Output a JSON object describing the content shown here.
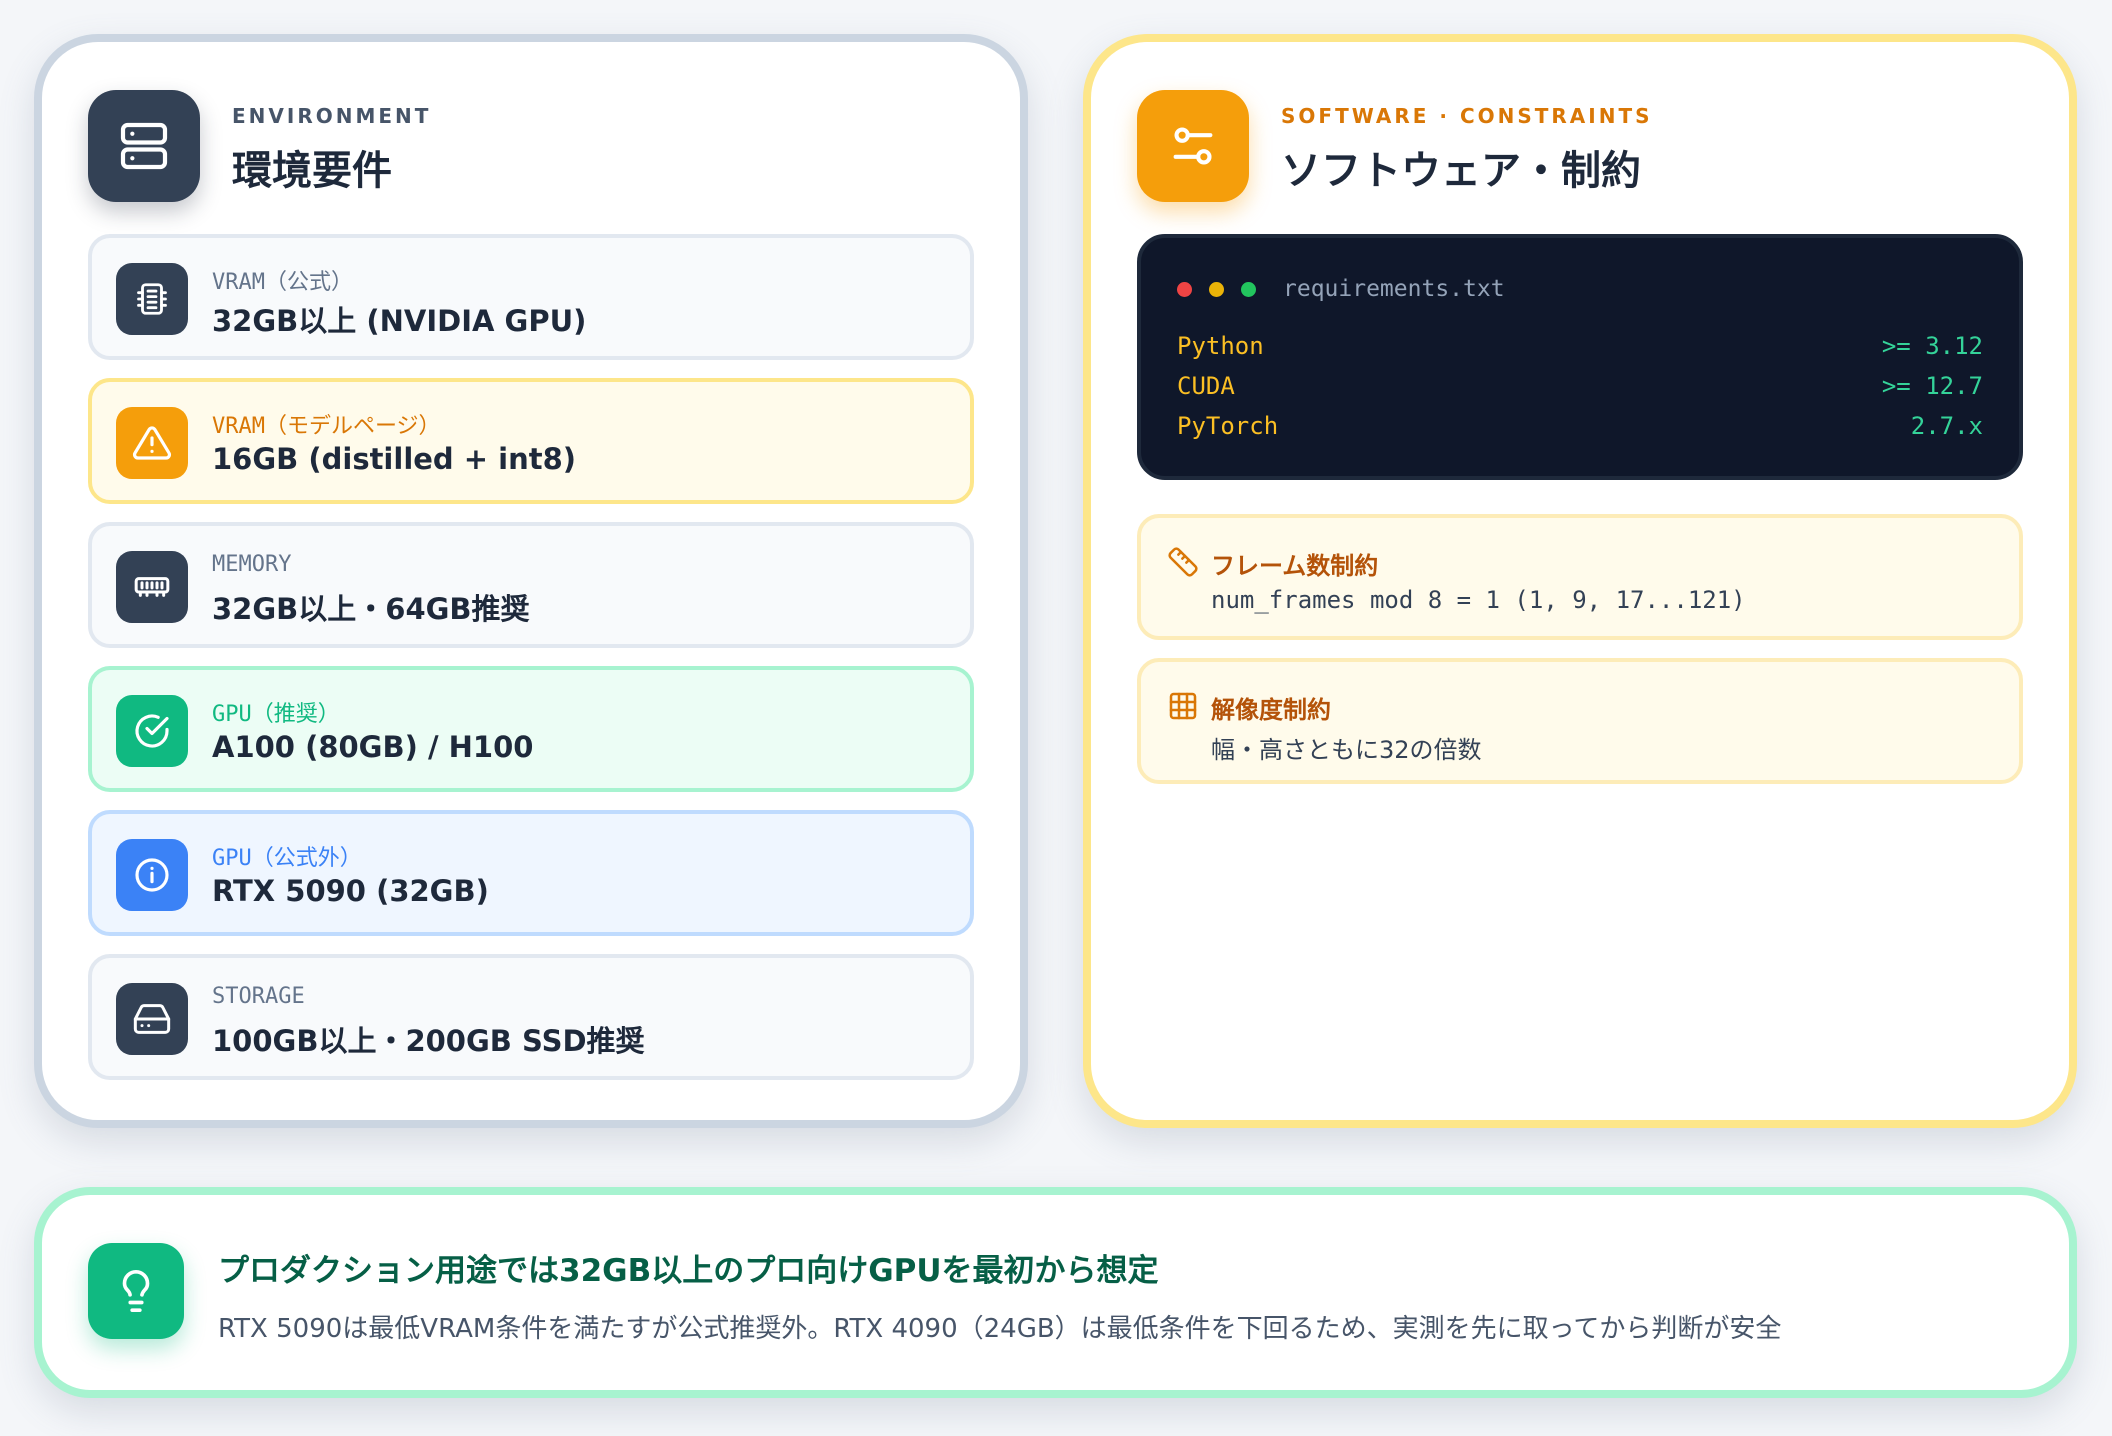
{
  "environment": {
    "subtitle": "ENVIRONMENT",
    "title": "環境要件",
    "header_icon": "server-icon",
    "items": [
      {
        "label": "VRAM（公式）",
        "value": "32GB以上 (NVIDIA GPU)",
        "icon": "cpu-chip-icon",
        "tone": "neutral"
      },
      {
        "label": "VRAM（モデルページ）",
        "value": "16GB (distilled + int8)",
        "icon": "warning-icon",
        "tone": "amber"
      },
      {
        "label": "MEMORY",
        "value": "32GB以上・64GB推奨",
        "icon": "memory-icon",
        "tone": "neutral"
      },
      {
        "label": "GPU（推奨）",
        "value": "A100 (80GB) / H100",
        "icon": "check-circle-icon",
        "tone": "green"
      },
      {
        "label": "GPU（公式外）",
        "value": "RTX 5090 (32GB)",
        "icon": "info-icon",
        "tone": "blue"
      },
      {
        "label": "STORAGE",
        "value": "100GB以上・200GB SSD推奨",
        "icon": "hard-drive-icon",
        "tone": "neutral"
      }
    ]
  },
  "software": {
    "subtitle": "SOFTWARE · CONSTRAINTS",
    "title": "ソフトウェア・制約",
    "header_icon": "settings-sliders-icon",
    "terminal": {
      "filename": "requirements.txt",
      "rows": [
        {
          "name": "Python",
          "version": ">= 3.12"
        },
        {
          "name": "CUDA",
          "version": ">= 12.7"
        },
        {
          "name": "PyTorch",
          "version": "2.7.x"
        }
      ]
    },
    "constraints": [
      {
        "title": "フレーム数制約",
        "text": "num_frames mod 8 = 1 (1, 9, 17...121)",
        "icon": "ruler-icon"
      },
      {
        "title": "解像度制約",
        "text": "幅・高さともに32の倍数",
        "icon": "grid-icon"
      }
    ]
  },
  "tip": {
    "icon": "lightbulb-icon",
    "title": "プロダクション用途では32GB以上のプロ向けGPUを最初から想定",
    "text": "RTX 5090は最低VRAM条件を満たすが公式推奨外。RTX 4090（24GB）は最低条件を下回るため、実測を先に取ってから判断が安全"
  },
  "colors": {
    "accent_amber": "#f59e0b",
    "accent_green": "#10b981",
    "accent_blue": "#3b82f6",
    "dark": "#334155"
  }
}
